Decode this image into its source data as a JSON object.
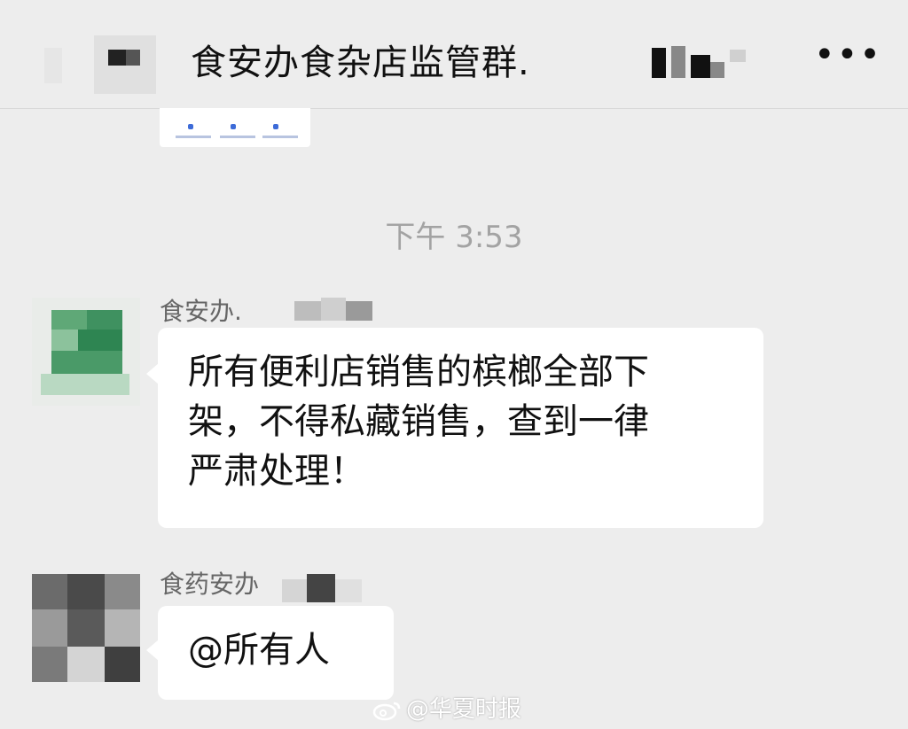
{
  "header": {
    "title": "食安办食杂店监管群.",
    "more_icon": "more-dots-icon",
    "more_glyph": "•••"
  },
  "chat": {
    "timestamp": "下午 3:53",
    "messages": [
      {
        "sender": "食安办.",
        "text_lines": [
          "所有便利店销售的槟榔全部下",
          "架，不得私藏销售，查到一律",
          "严肃处理！"
        ]
      },
      {
        "sender": "食药安办",
        "text_lines": [
          "@所有人"
        ]
      }
    ]
  },
  "watermark": {
    "text": "@华夏时报",
    "icon": "weibo-icon"
  },
  "colors": {
    "background": "#ededed",
    "bubble": "#ffffff",
    "timestamp": "#a3a3a3",
    "sender": "#666666"
  }
}
